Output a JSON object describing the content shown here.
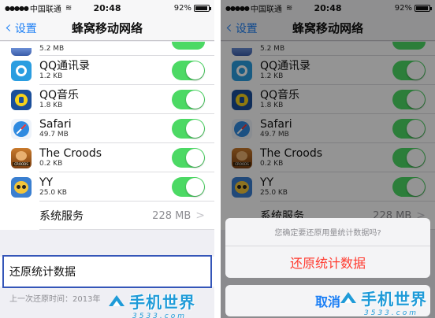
{
  "status_bar": {
    "carrier": "中国联通",
    "time": "20:48",
    "battery": "92%",
    "battery_level": 0.92
  },
  "navbar": {
    "back_label": "设置",
    "title": "蜂窝移动网络"
  },
  "apps": [
    {
      "name": "",
      "size": "5.2 MB",
      "icon": "app-icon-partial",
      "enabled": true
    },
    {
      "name": "QQ通讯录",
      "size": "1.2 KB",
      "icon": "qq-contacts-icon",
      "enabled": true
    },
    {
      "name": "QQ音乐",
      "size": "1.8 KB",
      "icon": "qq-music-icon",
      "enabled": true
    },
    {
      "name": "Safari",
      "size": "49.7 MB",
      "icon": "safari-icon",
      "enabled": true
    },
    {
      "name": "The Croods",
      "size": "0.2 KB",
      "icon": "the-croods-icon",
      "enabled": true
    },
    {
      "name": "YY",
      "size": "25.0 KB",
      "icon": "yy-icon",
      "enabled": true
    }
  ],
  "system_services": {
    "label": "系统服务",
    "value": "228 MB"
  },
  "reset": {
    "label": "还原统计数据",
    "last_reset": "上一次还原时间：2013年"
  },
  "action_sheet": {
    "message": "您确定要还原用量统计数据吗?",
    "confirm": "还原统计数据",
    "cancel": "取消"
  },
  "watermark": {
    "text": "手机世界",
    "sub": "3533.com"
  },
  "colors": {
    "toggle_on": "#4cd964",
    "ios_blue": "#1a7ef5",
    "destructive": "#ff3b30",
    "highlight_border": "#3455b8",
    "watermark": "#1f9bd8"
  }
}
